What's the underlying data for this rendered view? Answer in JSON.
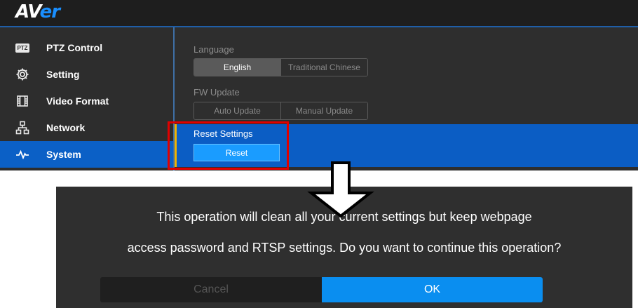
{
  "logo": {
    "text_main": "AV",
    "text_accent": "er"
  },
  "sidebar": {
    "items": [
      {
        "label": "PTZ Control",
        "icon": "ptz-icon",
        "icon_text": "PTZ"
      },
      {
        "label": "Setting",
        "icon": "gear-icon"
      },
      {
        "label": "Video Format",
        "icon": "film-icon"
      },
      {
        "label": "Network",
        "icon": "network-icon"
      },
      {
        "label": "System",
        "icon": "pulse-icon",
        "active": true
      }
    ]
  },
  "system": {
    "language": {
      "label": "Language",
      "options": [
        "English",
        "Traditional Chinese"
      ],
      "selected": "English"
    },
    "fw_update": {
      "label": "FW Update",
      "options": [
        "Auto Update",
        "Manual Update"
      ]
    },
    "reset": {
      "label": "Reset Settings",
      "button": "Reset"
    }
  },
  "dialog": {
    "line1": "This operation will clean all your current settings but keep webpage",
    "line2": "access password and RTSP settings. Do you want to continue this operation?",
    "cancel": "Cancel",
    "ok": "OK"
  },
  "colors": {
    "accent": "#0b5dc4",
    "highlight": "#e00000",
    "ok": "#0a8ef0"
  }
}
